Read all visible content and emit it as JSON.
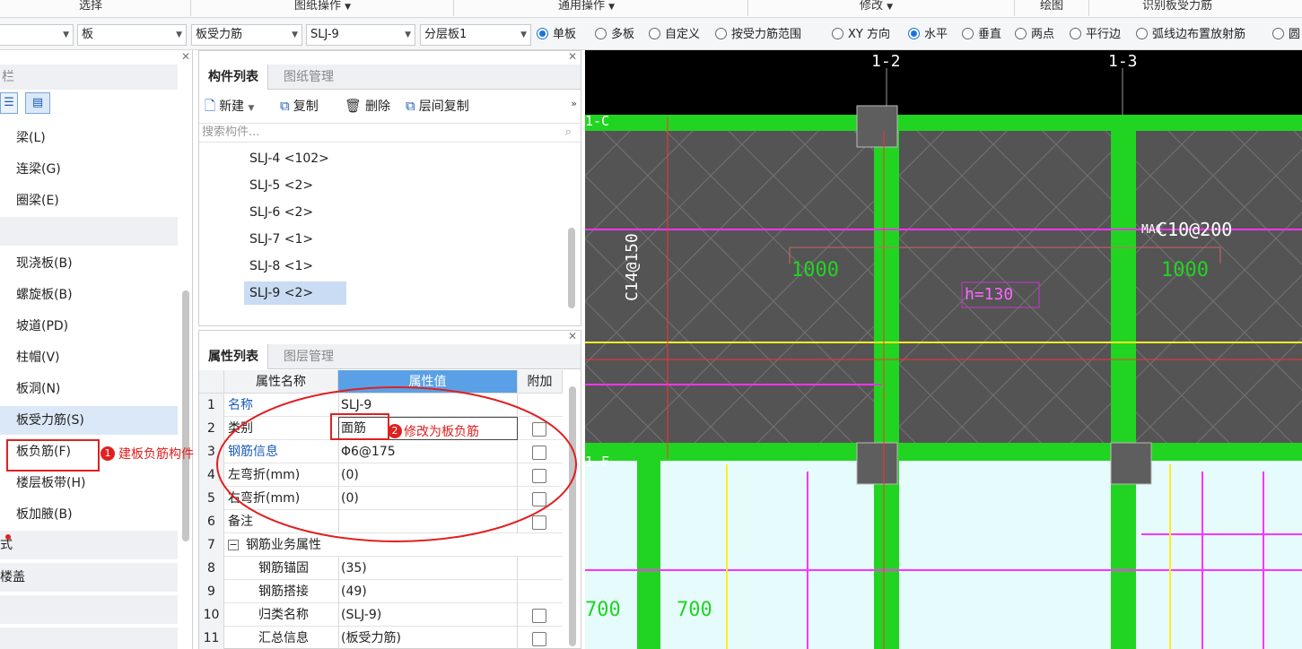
{
  "ribbon": {
    "select": "选择",
    "drawing_ops": "图纸操作",
    "general_ops": "通用操作",
    "modify": "修改",
    "draw": "绘图",
    "identify": "识别板受力筋"
  },
  "toolbar": {
    "combo_1": "",
    "combo_2": "板",
    "combo_3": "板受力筋",
    "combo_4": "SLJ-9",
    "combo_5": "分层板1",
    "radios": [
      "单板",
      "多板",
      "自定义",
      "按受力筋范围",
      "XY 方向",
      "水平",
      "垂直",
      "两点",
      "平行边",
      "弧线边布置放射筋",
      "圆"
    ]
  },
  "nav": {
    "header": "栏",
    "items": [
      "梁(L)",
      "连梁(G)",
      "圈梁(E)",
      "现浇板(B)",
      "螺旋板(B)",
      "坡道(PD)",
      "柱帽(V)",
      "板洞(N)",
      "板受力筋(S)",
      "板负筋(F)",
      "楼层板带(H)",
      "板加腋(B)"
    ],
    "groups": [
      "式",
      "楼盖"
    ]
  },
  "component": {
    "tabs": [
      "构件列表",
      "图纸管理"
    ],
    "new": "新建",
    "copy": "复制",
    "delete": "删除",
    "floor_copy": "层间复制",
    "search_placeholder": "搜索构件...",
    "rows": [
      "SLJ-4 <102>",
      "SLJ-5 <2>",
      "SLJ-6 <2>",
      "SLJ-7 <1>",
      "SLJ-8 <1>",
      "SLJ-9 <2>"
    ]
  },
  "props": {
    "tabs": [
      "属性列表",
      "图层管理"
    ],
    "headers": [
      "属性名称",
      "属性值",
      "附加"
    ],
    "rows": [
      {
        "n": "1",
        "name": "名称",
        "value": "SLJ-9"
      },
      {
        "n": "2",
        "name": "类别",
        "value": "面筋"
      },
      {
        "n": "3",
        "name": "钢筋信息",
        "value": "Φ6@175"
      },
      {
        "n": "4",
        "name": "左弯折(mm)",
        "value": "(0)"
      },
      {
        "n": "5",
        "name": "右弯折(mm)",
        "value": "(0)"
      },
      {
        "n": "6",
        "name": "备注",
        "value": ""
      },
      {
        "n": "7",
        "name": "钢筋业务属性",
        "value": ""
      },
      {
        "n": "8",
        "name": "钢筋锚固",
        "value": "(35)"
      },
      {
        "n": "9",
        "name": "钢筋搭接",
        "value": "(49)"
      },
      {
        "n": "10",
        "name": "归类名称",
        "value": "(SLJ-9)"
      },
      {
        "n": "11",
        "name": "汇总信息",
        "value": "(板受力筋)"
      }
    ]
  },
  "drawing": {
    "axis_12": "1-2",
    "axis_13": "1-3",
    "axis_c": "1-C",
    "axis_f": "1-F",
    "rebar_c14": "C14@150",
    "rebar_c10": "C10@200",
    "rebar_prefix": "MAC",
    "dim_left": "1000",
    "dim_right": "1000",
    "thickness": "h=130",
    "dim_700a": "700",
    "dim_700b": "700"
  },
  "annotations": {
    "a1_num": "1",
    "a1_text": "建板负筋构件",
    "a2_num": "2",
    "a2_text": "修改为板负筋"
  }
}
